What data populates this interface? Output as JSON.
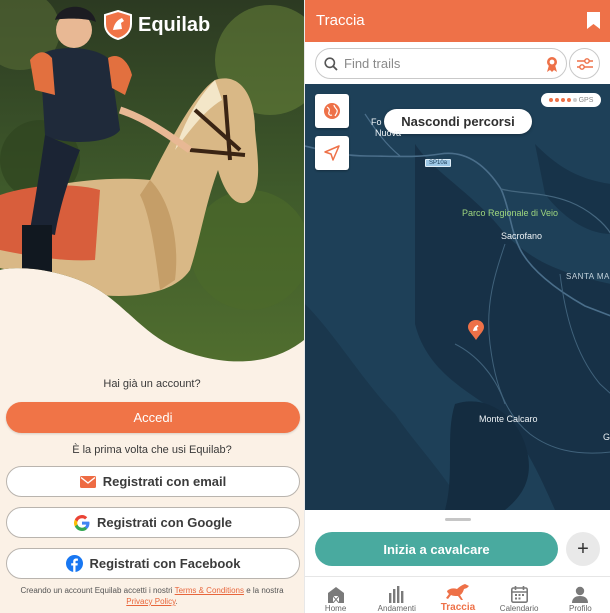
{
  "left": {
    "brand": "Equilab",
    "question_account": "Hai già un account?",
    "login_label": "Accedi",
    "question_first": "È la prima volta che usi Equilab?",
    "register_email": "Registrati con email",
    "register_google": "Registrati con Google",
    "register_facebook": "Registrati con Facebook",
    "legal_prefix": "Creando un account Equilab accetti i nostri",
    "terms_link": "Terms & Conditions",
    "legal_mid": "e la nostra",
    "privacy_link": "Privacy Policy",
    "legal_suffix": ".",
    "icons": {
      "logo": "horse-shield-icon",
      "email": "envelope-icon",
      "google": "google-icon",
      "facebook": "facebook-icon"
    },
    "colors": {
      "accent": "#f07447",
      "cream": "#fbf1e6"
    }
  },
  "right": {
    "title": "Traccia",
    "search_placeholder": "Find trails",
    "hide_routes": "Nascondi percorsi",
    "gps_label": "GPS",
    "gps_level": 4,
    "gps_max": 5,
    "map_labels": {
      "fornuova_1": "Fo",
      "fornuova_2": "Nuova",
      "road": "SP10a",
      "park": "Parco Regionale di Veio",
      "sacrofano": "Sacrofano",
      "santa_ma": "SANTA MA",
      "monte_calcaro": "Monte Calcaro",
      "edge_g": "G"
    },
    "start_ride": "Inizia a cavalcare",
    "plus": "+",
    "tabs": [
      {
        "label": "Home",
        "icon": "barn-icon"
      },
      {
        "label": "Andamenti",
        "icon": "bar-chart-icon"
      },
      {
        "label": "Traccia",
        "icon": "galloping-horse-icon"
      },
      {
        "label": "Calendario",
        "icon": "calendar-icon"
      },
      {
        "label": "Profilo",
        "icon": "person-icon"
      }
    ],
    "active_tab": "Traccia",
    "colors": {
      "header": "#ee7148",
      "teal": "#49aa9f",
      "map": "#1d3f55"
    }
  }
}
